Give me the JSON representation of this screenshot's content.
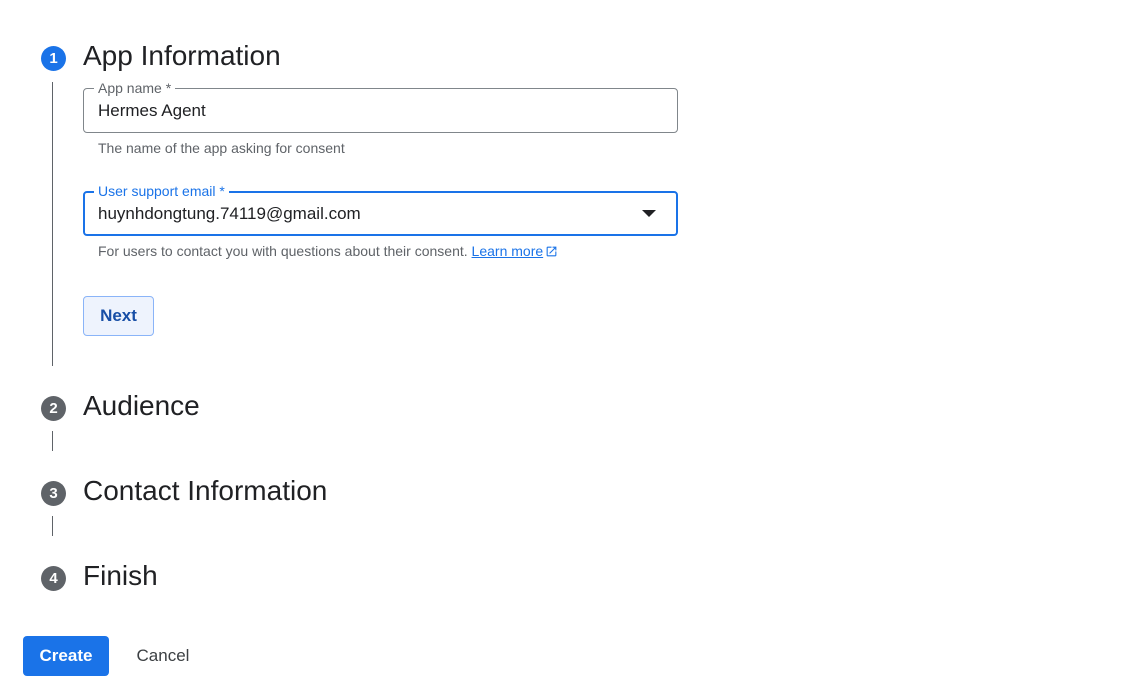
{
  "steps": [
    {
      "number": "1",
      "title": "App Information",
      "state": "active"
    },
    {
      "number": "2",
      "title": "Audience",
      "state": "inactive"
    },
    {
      "number": "3",
      "title": "Contact Information",
      "state": "inactive"
    },
    {
      "number": "4",
      "title": "Finish",
      "state": "inactive"
    }
  ],
  "app_name_field": {
    "label": "App name *",
    "value": "Hermes Agent",
    "hint": "The name of the app asking for consent"
  },
  "support_email_field": {
    "label": "User support email *",
    "value": "huynhdongtung.74119@gmail.com",
    "hint": "For users to contact you with questions about their consent.",
    "link_text": "Learn more",
    "link_icon": "open-in-new-icon"
  },
  "buttons": {
    "next": "Next",
    "create": "Create",
    "cancel": "Cancel"
  },
  "colors": {
    "accent": "#1a73e8",
    "inactive_step": "#5f6368"
  }
}
